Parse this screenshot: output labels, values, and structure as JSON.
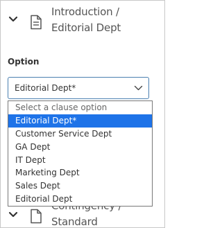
{
  "section": {
    "title_line1": "Introduction /",
    "title_line2": "Editorial Dept"
  },
  "field": {
    "label": "Option",
    "selected_value": "Editorial Dept*"
  },
  "dropdown": {
    "options": [
      "Select a clause option",
      "Editorial Dept*",
      "Customer Service Dept",
      "GA Dept",
      "IT Dept",
      "Marketing Dept",
      "Sales Dept",
      "Editorial Dept"
    ],
    "highlighted_index": 1
  },
  "next_section": {
    "title_line1": "Contingency /",
    "title_line2": "Standard"
  },
  "colors": {
    "highlight": "#1e73e8",
    "select_border": "#4a7fb0",
    "text": "#333333",
    "title": "#555555"
  }
}
